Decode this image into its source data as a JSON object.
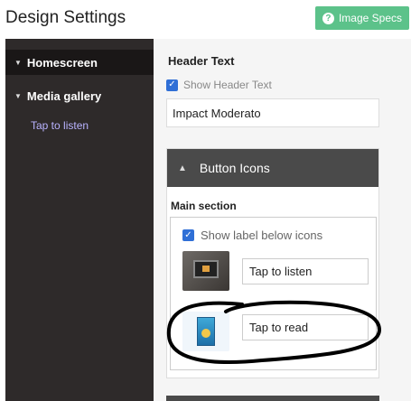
{
  "page": {
    "title": "Design Settings"
  },
  "toolbar": {
    "image_specs_label": "Image Specs",
    "image_specs_icon": "question-circle-icon"
  },
  "sidebar": {
    "items": [
      {
        "label": "Homescreen",
        "active": true
      },
      {
        "label": "Media gallery",
        "active": false
      }
    ],
    "sub_items": [
      {
        "label": "Tap to listen"
      }
    ]
  },
  "header_text": {
    "title": "Header Text",
    "show_label": "Show Header Text",
    "show_checked": true,
    "value": "Impact Moderato"
  },
  "button_icons": {
    "title": "Button Icons",
    "section_title": "Main section",
    "show_label_text": "Show label below icons",
    "show_label_checked": true,
    "items": [
      {
        "label": "Tap to listen",
        "thumbnail": "laptop-image"
      },
      {
        "label": "Tap to read",
        "thumbnail": "book-image"
      }
    ]
  },
  "colors": {
    "accent_green": "#5cc28a",
    "sidebar_bg": "#2e2a2a",
    "panel_header_bg": "#4a4a4a",
    "checkbox_blue": "#2f6fd6",
    "link_purple": "#b9b3ff"
  }
}
